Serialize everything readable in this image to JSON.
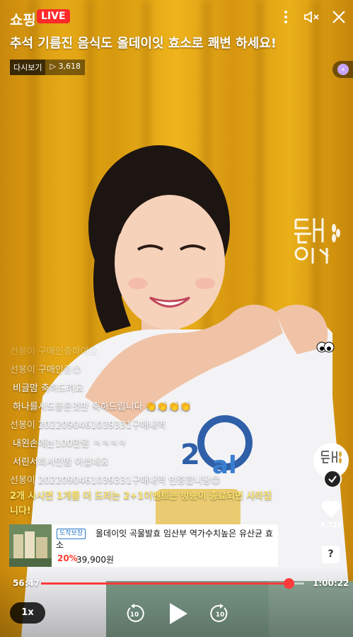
{
  "header": {
    "brand": "쇼핑",
    "live_badge": "LIVE",
    "title": "추석 기름진 음식도 올데이잇 효소로 쾌변 하세요!",
    "replay_tag": "다시보기",
    "view_count": "3,618",
    "more_icon": "more-vertical-icon",
    "mute_icon": "speaker-muted-icon",
    "close_icon": "close-icon"
  },
  "chat": {
    "messages": [
      {
        "nick": "선봉이",
        "text": "구매인증하여요"
      },
      {
        "nick": "선봉이",
        "text": "구매인증😊"
      },
      {
        "nick": "",
        "text": "비글맘 축하드려요"
      },
      {
        "nick": "",
        "text": "하나를사도좋은것만 축하드립니다 👏👏👏👏"
      },
      {
        "nick": "선봉이",
        "text": "2022090461039331구매내역"
      },
      {
        "nick": "",
        "text": "내왼손에는100만원 ㅋㅋㅋㅋ"
      },
      {
        "nick": "",
        "text": "서린서희서인맘 아쉽네요"
      },
      {
        "nick": "선봉이",
        "text": "2022090461039331구매내역 인증합니당😊"
      }
    ],
    "notice": "2개 사시면 1개를 더 드리는 2+1이벤트는 방송이 종료되면 사라집니다!"
  },
  "product": {
    "badge": "도착보장",
    "name": "올데이잇 곡물발효 임산부 역가수치높은 유산균 효소",
    "discount": "20%",
    "price": "39,900원"
  },
  "actions": {
    "like_count": "3,729",
    "info_symbol": "?"
  },
  "player": {
    "elapsed": "56:47",
    "duration": "1:00:22",
    "progress": 0.94,
    "speed": "1x",
    "rewind_seconds": "10",
    "forward_seconds": "10"
  },
  "colors": {
    "live": "#ff2a2a",
    "progress": "#ff3b3b",
    "notice": "#ffe66d",
    "discount": "#ff3b30"
  }
}
